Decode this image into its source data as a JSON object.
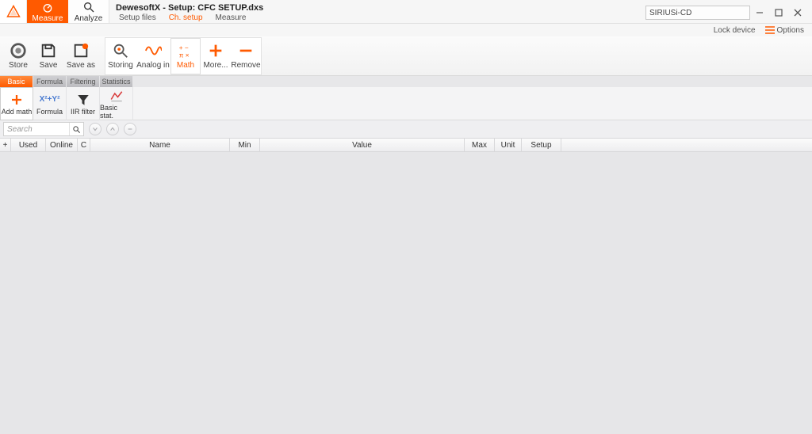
{
  "titlebar": {
    "title": "DewesoftX - Setup: CFC SETUP.dxs",
    "tabs": {
      "measure": "Measure",
      "analyze": "Analyze"
    },
    "sub_tabs": {
      "setup_files": "Setup files",
      "ch_setup": "Ch. setup",
      "measure": "Measure"
    },
    "device": "SIRIUSi-CD",
    "lock_device": "Lock device",
    "options": "Options"
  },
  "ribbon": {
    "store": "Store",
    "save": "Save",
    "save_as": "Save as",
    "storing": "Storing",
    "analog_in": "Analog in",
    "math": "Math",
    "more": "More...",
    "remove": "Remove"
  },
  "categories": {
    "basic": "Basic",
    "formula": "Formula ...",
    "filtering": "Filtering",
    "statistics": "Statistics",
    "add_math": "Add math",
    "formula_btn": "Formula",
    "iir_filter": "IIR filter",
    "basic_stat": "Basic stat."
  },
  "search": {
    "placeholder": "Search"
  },
  "columns": {
    "plus": "+",
    "used": "Used",
    "online": "Online",
    "c": "C",
    "name": "Name",
    "min": "Min",
    "value": "Value",
    "max": "Max",
    "unit": "Unit",
    "setup": "Setup"
  }
}
